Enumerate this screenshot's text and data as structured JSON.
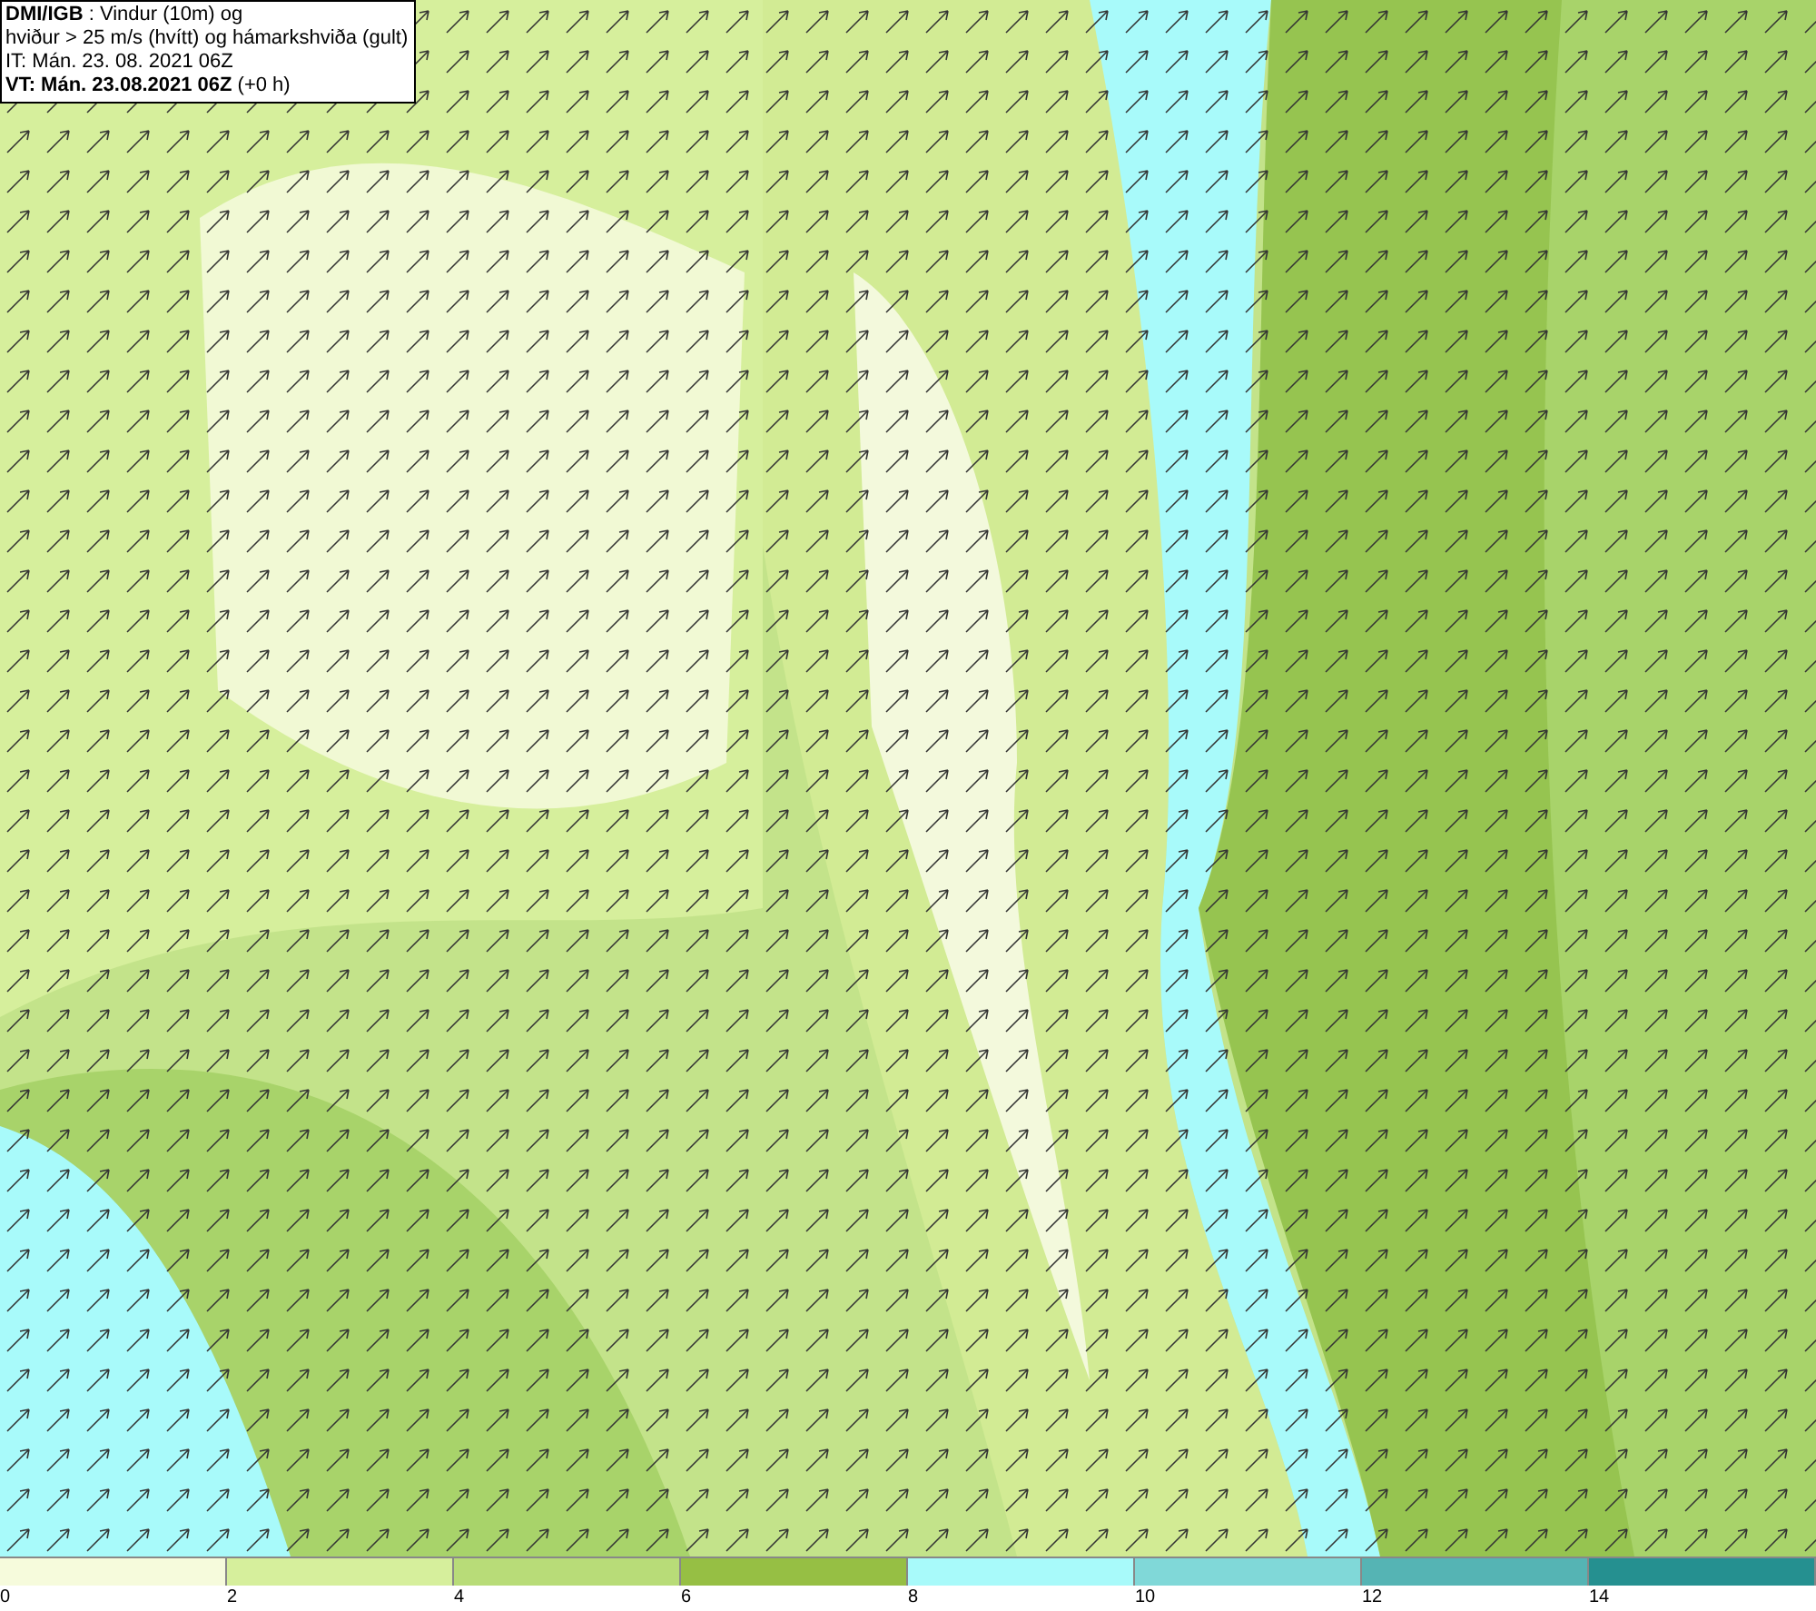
{
  "info_box": {
    "lines": [
      "**DMI/IGB** : Vindur (10m) og",
      "hviður > 25 m/s (hvítt) og hámarkshviða (gult)",
      "IT: Mán. 23. 08. 2021 06Z",
      "**VT: Mán. 23.08.2021 06Z** (+0 h)"
    ]
  },
  "legend": [
    {
      "label": "0",
      "color": "#f6fbdc"
    },
    {
      "label": "2",
      "color": "#d6ef9c"
    },
    {
      "label": "4",
      "color": "#b8dc78"
    },
    {
      "label": "6",
      "color": "#96bf44"
    },
    {
      "label": "8",
      "color": "#a8fafa"
    },
    {
      "label": "10",
      "color": "#80d8d8"
    },
    {
      "label": "12",
      "color": "#55b4b4"
    },
    {
      "label": "14",
      "color": "#259090"
    }
  ]
}
